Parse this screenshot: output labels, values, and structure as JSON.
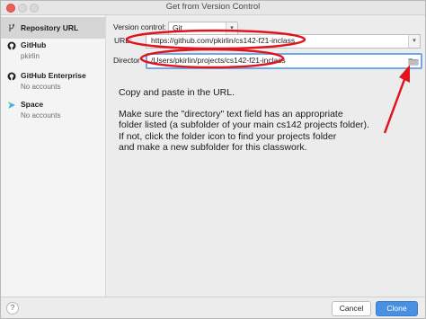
{
  "window": {
    "title": "Get from Version Control"
  },
  "sidebar": {
    "items": [
      {
        "label": "Repository URL",
        "sub": ""
      },
      {
        "label": "GitHub",
        "sub": "pkirlin"
      },
      {
        "label": "GitHub Enterprise",
        "sub": "No accounts"
      },
      {
        "label": "Space",
        "sub": "No accounts"
      }
    ]
  },
  "form": {
    "version_control_label": "Version control:",
    "version_control_value": "Git",
    "url_label": "URL:",
    "url_value": "https://github.com/pkirlin/cs142-f21-inclass",
    "directory_label": "Director",
    "directory_value": "/Users/pkirlin/projects/cs142-f21-inclass"
  },
  "annotation": {
    "line1": "Copy and paste in the URL.",
    "para2_l1": "Make sure the \"directory\" text field has an appropriate",
    "para2_l2": "folder listed (a subfolder of your main cs142 projects folder).",
    "para2_l3": "If not, click the folder icon to find your projects folder",
    "para2_l4": "and make a new subfolder for this classwork.",
    "highlight_color": "#e0141e"
  },
  "footer": {
    "help_label": "?",
    "cancel_label": "Cancel",
    "clone_label": "Clone"
  },
  "colors": {
    "primary_button": "#4a90e2",
    "focus_border": "#6ea8e8",
    "selection": "#d5d5d5"
  }
}
